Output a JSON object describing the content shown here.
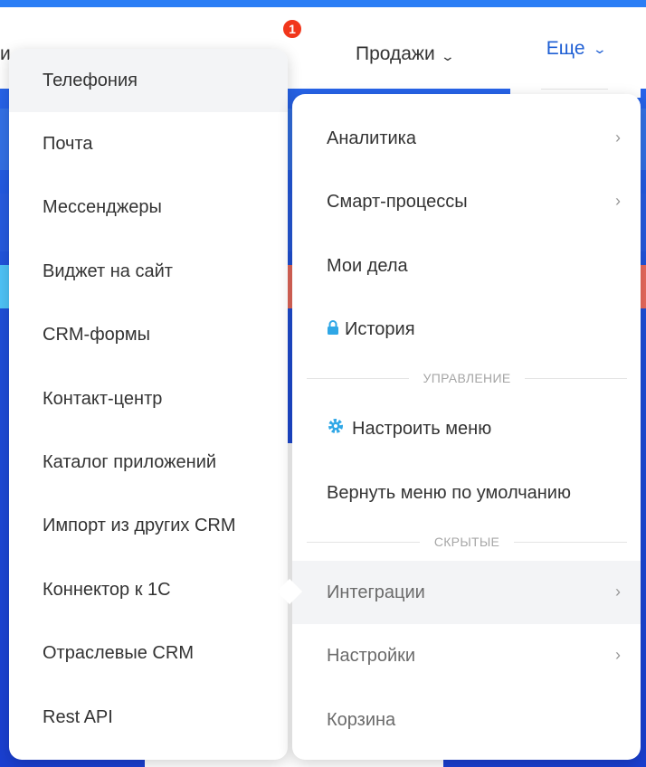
{
  "header": {
    "left_tab_fragment": "и",
    "notification_count": "1",
    "sales_tab": "Продажи",
    "more_tab": "Еще"
  },
  "submenu": {
    "items": [
      {
        "label": "Телефония"
      },
      {
        "label": "Почта"
      },
      {
        "label": "Мессенджеры"
      },
      {
        "label": "Виджет на сайт"
      },
      {
        "label": "CRM-формы"
      },
      {
        "label": "Контакт-центр"
      },
      {
        "label": "Каталог приложений"
      },
      {
        "label": "Импорт из других CRM"
      },
      {
        "label": "Коннектор к 1С"
      },
      {
        "label": "Отраслевые CRM"
      },
      {
        "label": "Rest API"
      }
    ]
  },
  "mainmenu": {
    "analytics": "Аналитика",
    "smart_processes": "Смарт-процессы",
    "my_tasks": "Мои дела",
    "history": "История",
    "section_manage": "УПРАВЛЕНИЕ",
    "configure_menu": "Настроить меню",
    "reset_menu": "Вернуть меню по умолчанию",
    "section_hidden": "СКРЫТЫЕ",
    "integrations": "Интеграции",
    "settings": "Настройки",
    "trash": "Корзина"
  },
  "colors": {
    "accent": "#1f5fd4",
    "badge": "#f1361b",
    "icon_blue": "#2fa7e6"
  },
  "icons": {
    "chevron_down": "chevron-down-icon",
    "chevron_right": "chevron-right-icon",
    "lock": "lock-icon",
    "gear": "gear-icon"
  }
}
